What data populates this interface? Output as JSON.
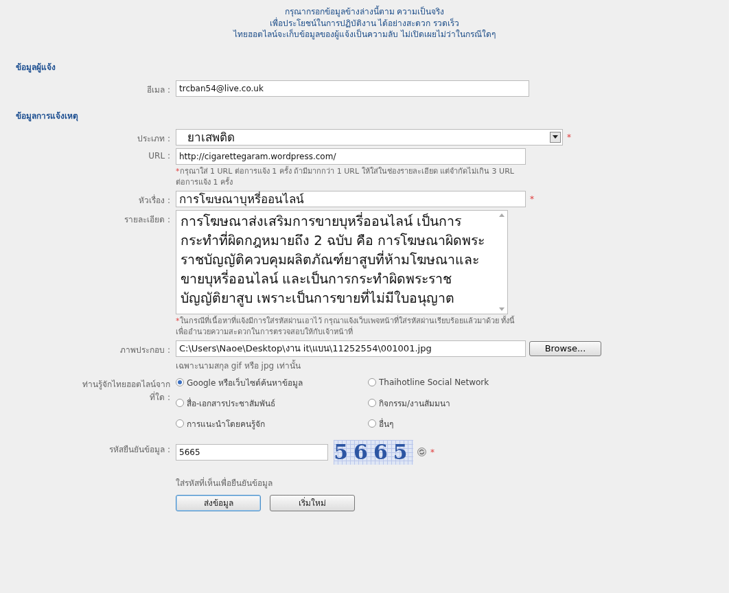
{
  "intro": [
    "กรุณากรอกข้อมูลข้างล่างนี้ตาม ความเป็นจริง",
    "เพื่อประโยชน์ในการปฏิบัติงาน ได้อย่างสะดวก รวดเร็ว",
    "ไทยฮอตไลน์จะเก็บข้อมูลของผู้แจ้งเป็นความลับ ไม่เปิดเผยไม่ว่าในกรณีใดๆ"
  ],
  "sections": [
    {
      "heading": "ข้อมูลผู้แจ้ง",
      "rows": [
        {
          "kind": "text",
          "label": "อีเมล :",
          "value": "trcban54@live.co.uk"
        }
      ]
    },
    {
      "heading": "ข้อมูลการแจ้งเหตุ",
      "rows": [
        {
          "kind": "select",
          "label": "ประเภท :",
          "value": "ยาเสพติด",
          "required_mark": "*"
        },
        {
          "kind": "text",
          "label": "URL :",
          "value": "http://cigarettegaram.wordpress.com/",
          "note_mark": "*",
          "note": "กรุณาใส่ 1 URL ต่อการแจ้ง 1 ครั้ง ถ้ามีมากกว่า 1 URL ให้ใส่ในช่องรายละเอียด แต่จำกัดไม่เกิน 3 URL ต่อการแจ้ง 1 ครั้ง"
        },
        {
          "kind": "bigtext",
          "label": "หัวเรื่อง :",
          "value": "การโฆษณาบุหรี่ออนไลน์",
          "required_mark": "*"
        },
        {
          "kind": "textarea",
          "label": "รายละเอียด :",
          "value": "การโฆษณาส่งเสริมการขายบุหรี่ออนไลน์ เป็นการกระทำที่ผิดกฎหมายถึง 2 ฉบับ คือ การโฆษณาผิดพระราชบัญญัติควบคุมผลิตภัณฑ์ยาสูบที่ห้ามโฆษณาและขายบุหรี่ออนไลน์ และเป็นการกระทำผิดพระราชบัญญัติยาสูบ เพราะเป็นการขายที่ไม่มีใบอนุญาต",
          "note_mark": "*",
          "note": "ในกรณีที่เนื้อหาที่แจ้งมีการใส่รหัสผ่านเอาไว้ กรุณาแจ้งเว็บเพจหน้าที่ใส่รหัสผ่านเรียบร้อยแล้วมาด้วย ทั้งนี้ เพื่ออำนวยความสะดวกในการตรวจสอบให้กับเจ้าหน้าที่"
        },
        {
          "kind": "file",
          "label": "ภาพประกอบ :",
          "value": "C:\\Users\\Naoe\\Desktop\\งาน it\\แบน\\11252554\\001001.jpg",
          "button": "Browse...",
          "hint": "เฉพาะนามสกุล gif หรือ jpg เท่านั้น"
        },
        {
          "kind": "radios",
          "label": "ท่านรู้จักไทยฮอตไลน์จากที่ใด :",
          "options": [
            {
              "label": "Google หรือเว็บไซต์ค้นหาข้อมูล",
              "selected": true
            },
            {
              "label": "Thaihotline Social Network",
              "selected": false
            },
            {
              "label": "สื่อ-เอกสารประชาสัมพันธ์",
              "selected": false
            },
            {
              "label": "กิจกรรม/งานสัมมนา",
              "selected": false
            },
            {
              "label": "การแนะนำโดยคนรู้จัก",
              "selected": false
            },
            {
              "label": "อื่นๆ",
              "selected": false
            }
          ]
        },
        {
          "kind": "captcha",
          "label": "รหัสยืนยันข้อมูล :",
          "value": "5665",
          "captcha_text": "5665",
          "required_mark": "*",
          "hint": "ใส่รหัสที่เห็นเพื่อยืนยันข้อมูล"
        }
      ]
    }
  ],
  "buttons": [
    {
      "label": "ส่งข้อมูล",
      "focused": true
    },
    {
      "label": "เริ่มใหม่",
      "focused": false
    }
  ]
}
